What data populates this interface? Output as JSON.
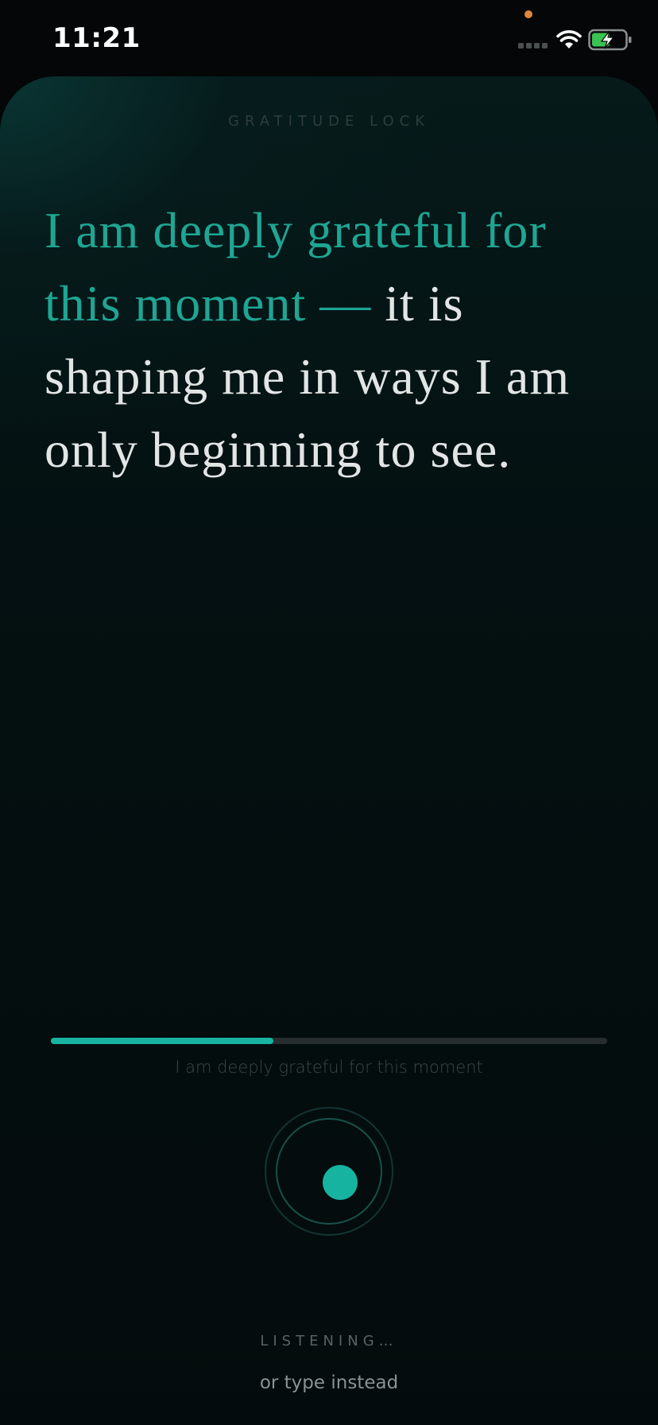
{
  "status_bar": {
    "time": "11:21",
    "icons": [
      "privacy-dot",
      "cellular-signal-icon",
      "wifi-icon",
      "battery-charging-icon"
    ]
  },
  "app": {
    "title": "GRATITUDE LOCK"
  },
  "affirmation": {
    "spoken_text": "I am deeply grateful for this moment —",
    "remaining_text": " it is shaping me in ways I am only beginning to see."
  },
  "progress": {
    "fraction": 0.4
  },
  "transcript": {
    "text": "I am deeply grateful for this moment"
  },
  "mic": {
    "status_label": "LISTENING…"
  },
  "actions": {
    "type_instead_label": "or type instead"
  },
  "colors": {
    "accent": "#18b3a1",
    "text_primary": "#e2e5e5",
    "background": "#040607",
    "privacy_dot": "#e0873b",
    "battery_charge": "#3ac252"
  }
}
